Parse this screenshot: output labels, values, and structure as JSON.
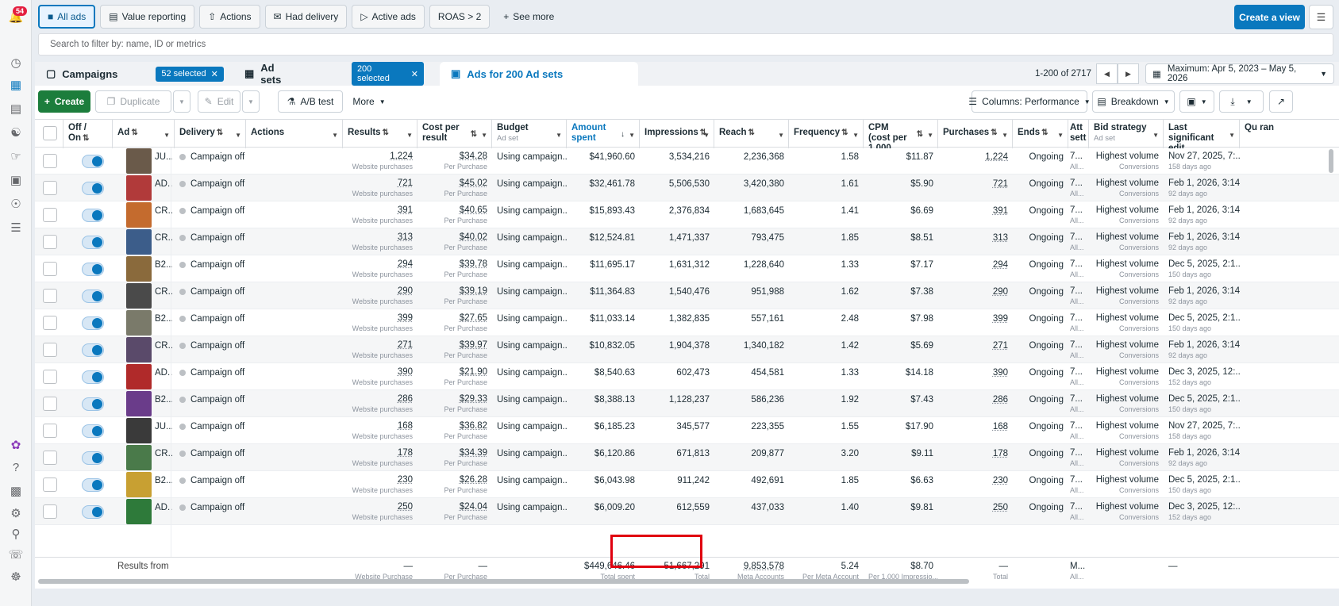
{
  "rail": {
    "notif_count": "54",
    "top_icons": [
      "bell-icon",
      "dashboard-icon",
      "table-icon",
      "report-icon",
      "audience-icon",
      "megaphone-icon",
      "billing-icon",
      "network-icon",
      "menu-icon"
    ],
    "bottom_icons": [
      "meta-ai-icon",
      "help-icon",
      "id-card-icon",
      "gear-icon",
      "search-icon",
      "support-icon",
      "bug-icon"
    ]
  },
  "topbar": {
    "chips": [
      {
        "label": "All ads",
        "icon": "folder-icon",
        "active": true
      },
      {
        "label": "Value reporting",
        "icon": "doc-icon",
        "active": false
      },
      {
        "label": "Actions",
        "icon": "up-arrow-icon",
        "active": false
      },
      {
        "label": "Had delivery",
        "icon": "envelope-icon",
        "active": false
      },
      {
        "label": "Active ads",
        "icon": "play-icon",
        "active": false
      },
      {
        "label": "ROAS > 2",
        "icon": "",
        "active": false
      }
    ],
    "see_more": "See more",
    "create_view": "Create a view"
  },
  "search": {
    "placeholder": "Search to filter by: name, ID or metrics"
  },
  "tabs": {
    "campaigns": {
      "label": "Campaigns",
      "selected": "52 selected"
    },
    "adsets": {
      "label": "Ad sets",
      "selected": "200 selected"
    },
    "ads": {
      "label": "Ads for 200 Ad sets"
    }
  },
  "pager": {
    "range": "1-200 of 2717"
  },
  "daterange": "Maximum: Apr 5, 2023 – May 5, 2026",
  "toolbar": {
    "create": "Create",
    "duplicate": "Duplicate",
    "edit": "Edit",
    "abtest": "A/B test",
    "more": "More",
    "columns": "Columns: Performance",
    "breakdown": "Breakdown"
  },
  "headers": {
    "offon": "Off / On",
    "ad": "Ad",
    "delivery": "Delivery",
    "actions": "Actions",
    "results": "Results",
    "cpr": "Cost per result",
    "budget": "Budget",
    "budget_sub": "Ad set",
    "amount": "Amount spent",
    "impressions": "Impressions",
    "reach": "Reach",
    "frequency": "Frequency",
    "cpm": "CPM (cost per 1,000...",
    "purchases": "Purchases",
    "ends": "Ends",
    "attr": "Att sett",
    "bid": "Bid strategy",
    "bid_sub": "Ad set",
    "lastedit": "Last significant edit",
    "quality": "Qu ran"
  },
  "rows": [
    {
      "ad": "JU...",
      "delivery": "Campaign off",
      "results": "1,224",
      "results_sub": "Website purchases",
      "cpr": "$34.28",
      "cpr_sub": "Per Purchase",
      "budget": "Using campaign...",
      "amount": "$41,960.60",
      "impressions": "3,534,216",
      "reach": "2,236,368",
      "frequency": "1.58",
      "cpm": "$11.87",
      "purchases": "1,224",
      "ends": "Ongoing",
      "attr": "7...",
      "attr_sub": "All...",
      "bid": "Highest volume",
      "bid_sub": "Conversions",
      "edit": "Nov 27, 2025, 7:...",
      "edit_sub": "158 days ago",
      "thumb": "#6a5a4a"
    },
    {
      "ad": "AD...",
      "delivery": "Campaign off",
      "results": "721",
      "results_sub": "Website purchases",
      "cpr": "$45.02",
      "cpr_sub": "Per Purchase",
      "budget": "Using campaign...",
      "amount": "$32,461.78",
      "impressions": "5,506,530",
      "reach": "3,420,380",
      "frequency": "1.61",
      "cpm": "$5.90",
      "purchases": "721",
      "ends": "Ongoing",
      "attr": "7...",
      "attr_sub": "All...",
      "bid": "Highest volume",
      "bid_sub": "Conversions",
      "edit": "Feb 1, 2026, 3:14...",
      "edit_sub": "92 days ago",
      "thumb": "#b13a3a"
    },
    {
      "ad": "CR...",
      "delivery": "Campaign off",
      "results": "391",
      "results_sub": "Website purchases",
      "cpr": "$40.65",
      "cpr_sub": "Per Purchase",
      "budget": "Using campaign...",
      "amount": "$15,893.43",
      "impressions": "2,376,834",
      "reach": "1,683,645",
      "frequency": "1.41",
      "cpm": "$6.69",
      "purchases": "391",
      "ends": "Ongoing",
      "attr": "7...",
      "attr_sub": "All...",
      "bid": "Highest volume",
      "bid_sub": "Conversions",
      "edit": "Feb 1, 2026, 3:14...",
      "edit_sub": "92 days ago",
      "thumb": "#c46b2e"
    },
    {
      "ad": "CR...",
      "delivery": "Campaign off",
      "results": "313",
      "results_sub": "Website purchases",
      "cpr": "$40.02",
      "cpr_sub": "Per Purchase",
      "budget": "Using campaign...",
      "amount": "$12,524.81",
      "impressions": "1,471,337",
      "reach": "793,475",
      "frequency": "1.85",
      "cpm": "$8.51",
      "purchases": "313",
      "ends": "Ongoing",
      "attr": "7...",
      "attr_sub": "All...",
      "bid": "Highest volume",
      "bid_sub": "Conversions",
      "edit": "Feb 1, 2026, 3:14...",
      "edit_sub": "92 days ago",
      "thumb": "#3c5d8a"
    },
    {
      "ad": "B2...",
      "delivery": "Campaign off",
      "results": "294",
      "results_sub": "Website purchases",
      "cpr": "$39.78",
      "cpr_sub": "Per Purchase",
      "budget": "Using campaign...",
      "amount": "$11,695.17",
      "impressions": "1,631,312",
      "reach": "1,228,640",
      "frequency": "1.33",
      "cpm": "$7.17",
      "purchases": "294",
      "ends": "Ongoing",
      "attr": "7...",
      "attr_sub": "All...",
      "bid": "Highest volume",
      "bid_sub": "Conversions",
      "edit": "Dec 5, 2025, 2:1...",
      "edit_sub": "150 days ago",
      "thumb": "#8a6a3c"
    },
    {
      "ad": "CR...",
      "delivery": "Campaign off",
      "results": "290",
      "results_sub": "Website purchases",
      "cpr": "$39.19",
      "cpr_sub": "Per Purchase",
      "budget": "Using campaign...",
      "amount": "$11,364.83",
      "impressions": "1,540,476",
      "reach": "951,988",
      "frequency": "1.62",
      "cpm": "$7.38",
      "purchases": "290",
      "ends": "Ongoing",
      "attr": "7...",
      "attr_sub": "All...",
      "bid": "Highest volume",
      "bid_sub": "Conversions",
      "edit": "Feb 1, 2026, 3:14...",
      "edit_sub": "92 days ago",
      "thumb": "#4a4a4a"
    },
    {
      "ad": "B2...",
      "delivery": "Campaign off",
      "results": "399",
      "results_sub": "Website purchases",
      "cpr": "$27.65",
      "cpr_sub": "Per Purchase",
      "budget": "Using campaign...",
      "amount": "$11,033.14",
      "impressions": "1,382,835",
      "reach": "557,161",
      "frequency": "2.48",
      "cpm": "$7.98",
      "purchases": "399",
      "ends": "Ongoing",
      "attr": "7...",
      "attr_sub": "All...",
      "bid": "Highest volume",
      "bid_sub": "Conversions",
      "edit": "Dec 5, 2025, 2:1...",
      "edit_sub": "150 days ago",
      "thumb": "#7a7a6a"
    },
    {
      "ad": "CR...",
      "delivery": "Campaign off",
      "results": "271",
      "results_sub": "Website purchases",
      "cpr": "$39.97",
      "cpr_sub": "Per Purchase",
      "budget": "Using campaign...",
      "amount": "$10,832.05",
      "impressions": "1,904,378",
      "reach": "1,340,182",
      "frequency": "1.42",
      "cpm": "$5.69",
      "purchases": "271",
      "ends": "Ongoing",
      "attr": "7...",
      "attr_sub": "All...",
      "bid": "Highest volume",
      "bid_sub": "Conversions",
      "edit": "Feb 1, 2026, 3:14...",
      "edit_sub": "92 days ago",
      "thumb": "#5a4a6a"
    },
    {
      "ad": "AD...",
      "delivery": "Campaign off",
      "results": "390",
      "results_sub": "Website purchases",
      "cpr": "$21.90",
      "cpr_sub": "Per Purchase",
      "budget": "Using campaign...",
      "amount": "$8,540.63",
      "impressions": "602,473",
      "reach": "454,581",
      "frequency": "1.33",
      "cpm": "$14.18",
      "purchases": "390",
      "ends": "Ongoing",
      "attr": "7...",
      "attr_sub": "All...",
      "bid": "Highest volume",
      "bid_sub": "Conversions",
      "edit": "Dec 3, 2025, 12:...",
      "edit_sub": "152 days ago",
      "thumb": "#b02a2a"
    },
    {
      "ad": "B2...",
      "delivery": "Campaign off",
      "results": "286",
      "results_sub": "Website purchases",
      "cpr": "$29.33",
      "cpr_sub": "Per Purchase",
      "budget": "Using campaign...",
      "amount": "$8,388.13",
      "impressions": "1,128,237",
      "reach": "586,236",
      "frequency": "1.92",
      "cpm": "$7.43",
      "purchases": "286",
      "ends": "Ongoing",
      "attr": "7...",
      "attr_sub": "All...",
      "bid": "Highest volume",
      "bid_sub": "Conversions",
      "edit": "Dec 5, 2025, 2:1...",
      "edit_sub": "150 days ago",
      "thumb": "#6a3c8a"
    },
    {
      "ad": "JU...",
      "delivery": "Campaign off",
      "results": "168",
      "results_sub": "Website purchases",
      "cpr": "$36.82",
      "cpr_sub": "Per Purchase",
      "budget": "Using campaign...",
      "amount": "$6,185.23",
      "impressions": "345,577",
      "reach": "223,355",
      "frequency": "1.55",
      "cpm": "$17.90",
      "purchases": "168",
      "ends": "Ongoing",
      "attr": "7...",
      "attr_sub": "All...",
      "bid": "Highest volume",
      "bid_sub": "Conversions",
      "edit": "Nov 27, 2025, 7:...",
      "edit_sub": "158 days ago",
      "thumb": "#3a3a3a"
    },
    {
      "ad": "CR...",
      "delivery": "Campaign off",
      "results": "178",
      "results_sub": "Website purchases",
      "cpr": "$34.39",
      "cpr_sub": "Per Purchase",
      "budget": "Using campaign...",
      "amount": "$6,120.86",
      "impressions": "671,813",
      "reach": "209,877",
      "frequency": "3.20",
      "cpm": "$9.11",
      "purchases": "178",
      "ends": "Ongoing",
      "attr": "7...",
      "attr_sub": "All...",
      "bid": "Highest volume",
      "bid_sub": "Conversions",
      "edit": "Feb 1, 2026, 3:14...",
      "edit_sub": "92 days ago",
      "thumb": "#4a7a4a"
    },
    {
      "ad": "B2...",
      "delivery": "Campaign off",
      "results": "230",
      "results_sub": "Website purchases",
      "cpr": "$26.28",
      "cpr_sub": "Per Purchase",
      "budget": "Using campaign...",
      "amount": "$6,043.98",
      "impressions": "911,242",
      "reach": "492,691",
      "frequency": "1.85",
      "cpm": "$6.63",
      "purchases": "230",
      "ends": "Ongoing",
      "attr": "7...",
      "attr_sub": "All...",
      "bid": "Highest volume",
      "bid_sub": "Conversions",
      "edit": "Dec 5, 2025, 2:1...",
      "edit_sub": "150 days ago",
      "thumb": "#c8a032"
    },
    {
      "ad": "AD...",
      "delivery": "Campaign off",
      "results": "250",
      "results_sub": "Website purchases",
      "cpr": "$24.04",
      "cpr_sub": "Per Purchase",
      "budget": "Using campaign...",
      "amount": "$6,009.20",
      "impressions": "612,559",
      "reach": "437,033",
      "frequency": "1.40",
      "cpm": "$9.81",
      "purchases": "250",
      "ends": "Ongoing",
      "attr": "7...",
      "attr_sub": "All...",
      "bid": "Highest volume",
      "bid_sub": "Conversions",
      "edit": "Dec 3, 2025, 12:...",
      "edit_sub": "152 days ago",
      "thumb": "#2e7a3a"
    }
  ],
  "footer": {
    "label": "Results from :",
    "results": "—",
    "results_sub": "Website Purchase",
    "cpr": "—",
    "cpr_sub": "Per Purchase",
    "amount": "$449,646.46",
    "amount_sub": "Total spent",
    "impressions": "51,667,291",
    "impressions_sub": "Total",
    "reach": "9,853,578",
    "reach_sub": "Meta Accounts",
    "frequency": "5.24",
    "frequency_sub": "Per Meta Account",
    "cpm": "$8.70",
    "cpm_sub": "Per 1,000 Impressio...",
    "purchases": "—",
    "purchases_sub": "Total",
    "attr": "M...",
    "attr_sub": "All...",
    "lastedit": "—"
  },
  "colors": {
    "accent": "#0a78be",
    "create": "#1c7d3c",
    "highlight": "#e0000f"
  }
}
